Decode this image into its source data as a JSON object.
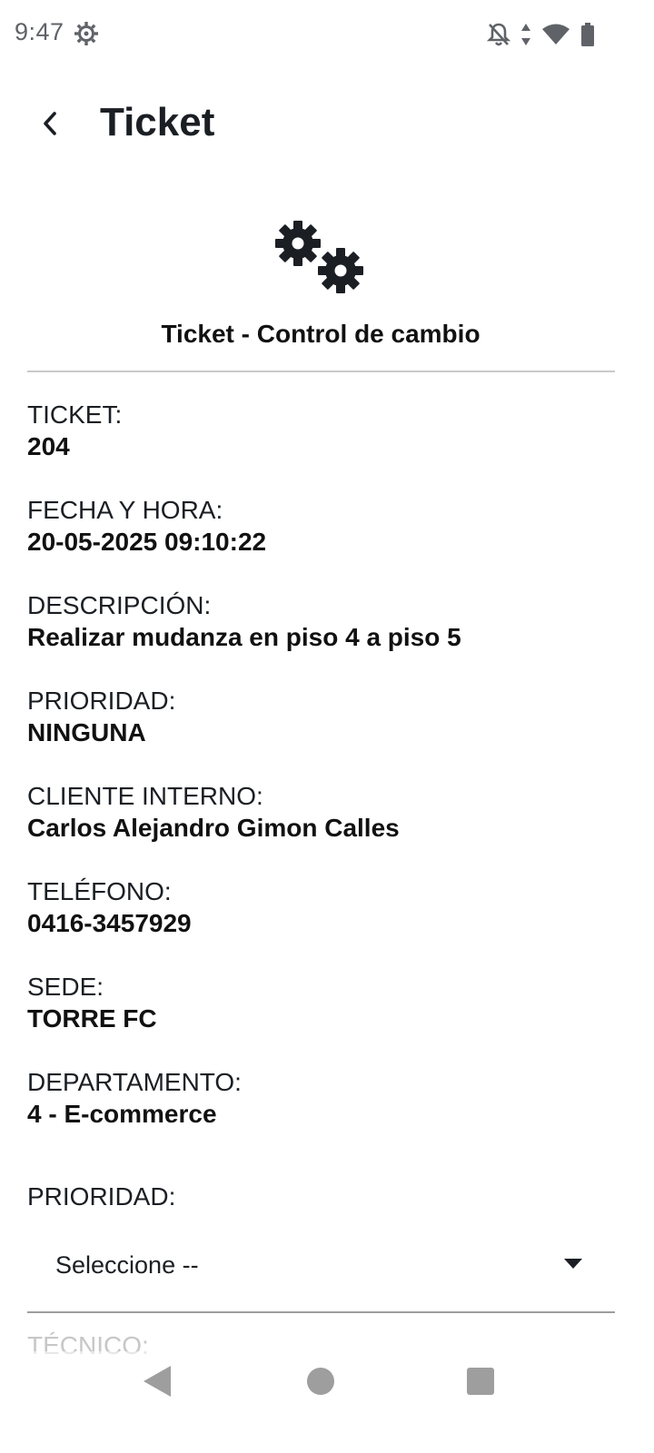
{
  "status_bar": {
    "time": "9:47",
    "icons": [
      "settings-icon",
      "notifications-off-icon",
      "data-arrows-icon",
      "wifi-icon",
      "battery-icon"
    ]
  },
  "app_bar": {
    "title": "Ticket",
    "back_icon": "chevron-left-icon"
  },
  "header": {
    "icon": "gears-icon",
    "heading": "Ticket - Control de cambio"
  },
  "fields": [
    {
      "label": "TICKET:",
      "value": "204"
    },
    {
      "label": "FECHA Y HORA:",
      "value": "20-05-2025 09:10:22"
    },
    {
      "label": "DESCRIPCIÓN:",
      "value": "Realizar mudanza en piso 4 a piso 5"
    },
    {
      "label": "PRIORIDAD:",
      "value": "NINGUNA"
    },
    {
      "label": "CLIENTE INTERNO:",
      "value": "Carlos Alejandro Gimon Calles"
    },
    {
      "label": "TELÉFONO:",
      "value": "0416-3457929"
    },
    {
      "label": "SEDE:",
      "value": "TORRE FC"
    },
    {
      "label": "DEPARTAMENTO:",
      "value": "4 - E-commerce"
    }
  ],
  "priority_select": {
    "label": "PRIORIDAD:",
    "selected": "Seleccione --"
  },
  "next_section": {
    "label": "TÉCNICO:"
  },
  "colors": {
    "text": "#1b1f24",
    "divider": "#c9c9c9",
    "nav": "#9e9e9e",
    "background": "#ffffff"
  }
}
